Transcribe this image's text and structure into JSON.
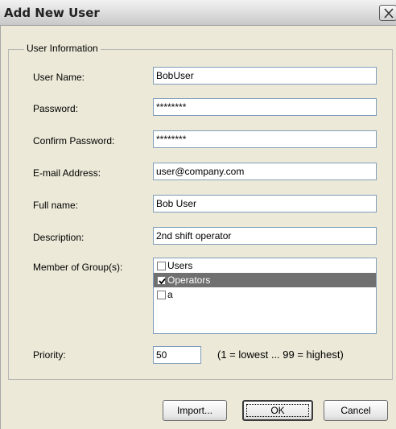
{
  "window": {
    "title": "Add New User"
  },
  "group": {
    "label": "User Information"
  },
  "fields": {
    "user_name": {
      "label": "User Name:",
      "value": "BobUser"
    },
    "password": {
      "label": "Password:",
      "value": "********"
    },
    "confirm_password": {
      "label": "Confirm Password:",
      "value": "********"
    },
    "email": {
      "label": "E-mail Address:",
      "value": "user@company.com"
    },
    "full_name": {
      "label": "Full name:",
      "value": "Bob User"
    },
    "description": {
      "label": "Description:",
      "value": "2nd shift operator"
    }
  },
  "groups": {
    "label": "Member of Group(s):",
    "items": [
      {
        "label": "Users",
        "checked": false,
        "selected": false
      },
      {
        "label": "Operators",
        "checked": true,
        "selected": true
      },
      {
        "label": "a",
        "checked": false,
        "selected": false
      }
    ]
  },
  "priority": {
    "label": "Priority:",
    "value": "50",
    "hint": "(1 = lowest ... 99 = highest)"
  },
  "buttons": {
    "import": "Import...",
    "ok": "OK",
    "cancel": "Cancel"
  }
}
